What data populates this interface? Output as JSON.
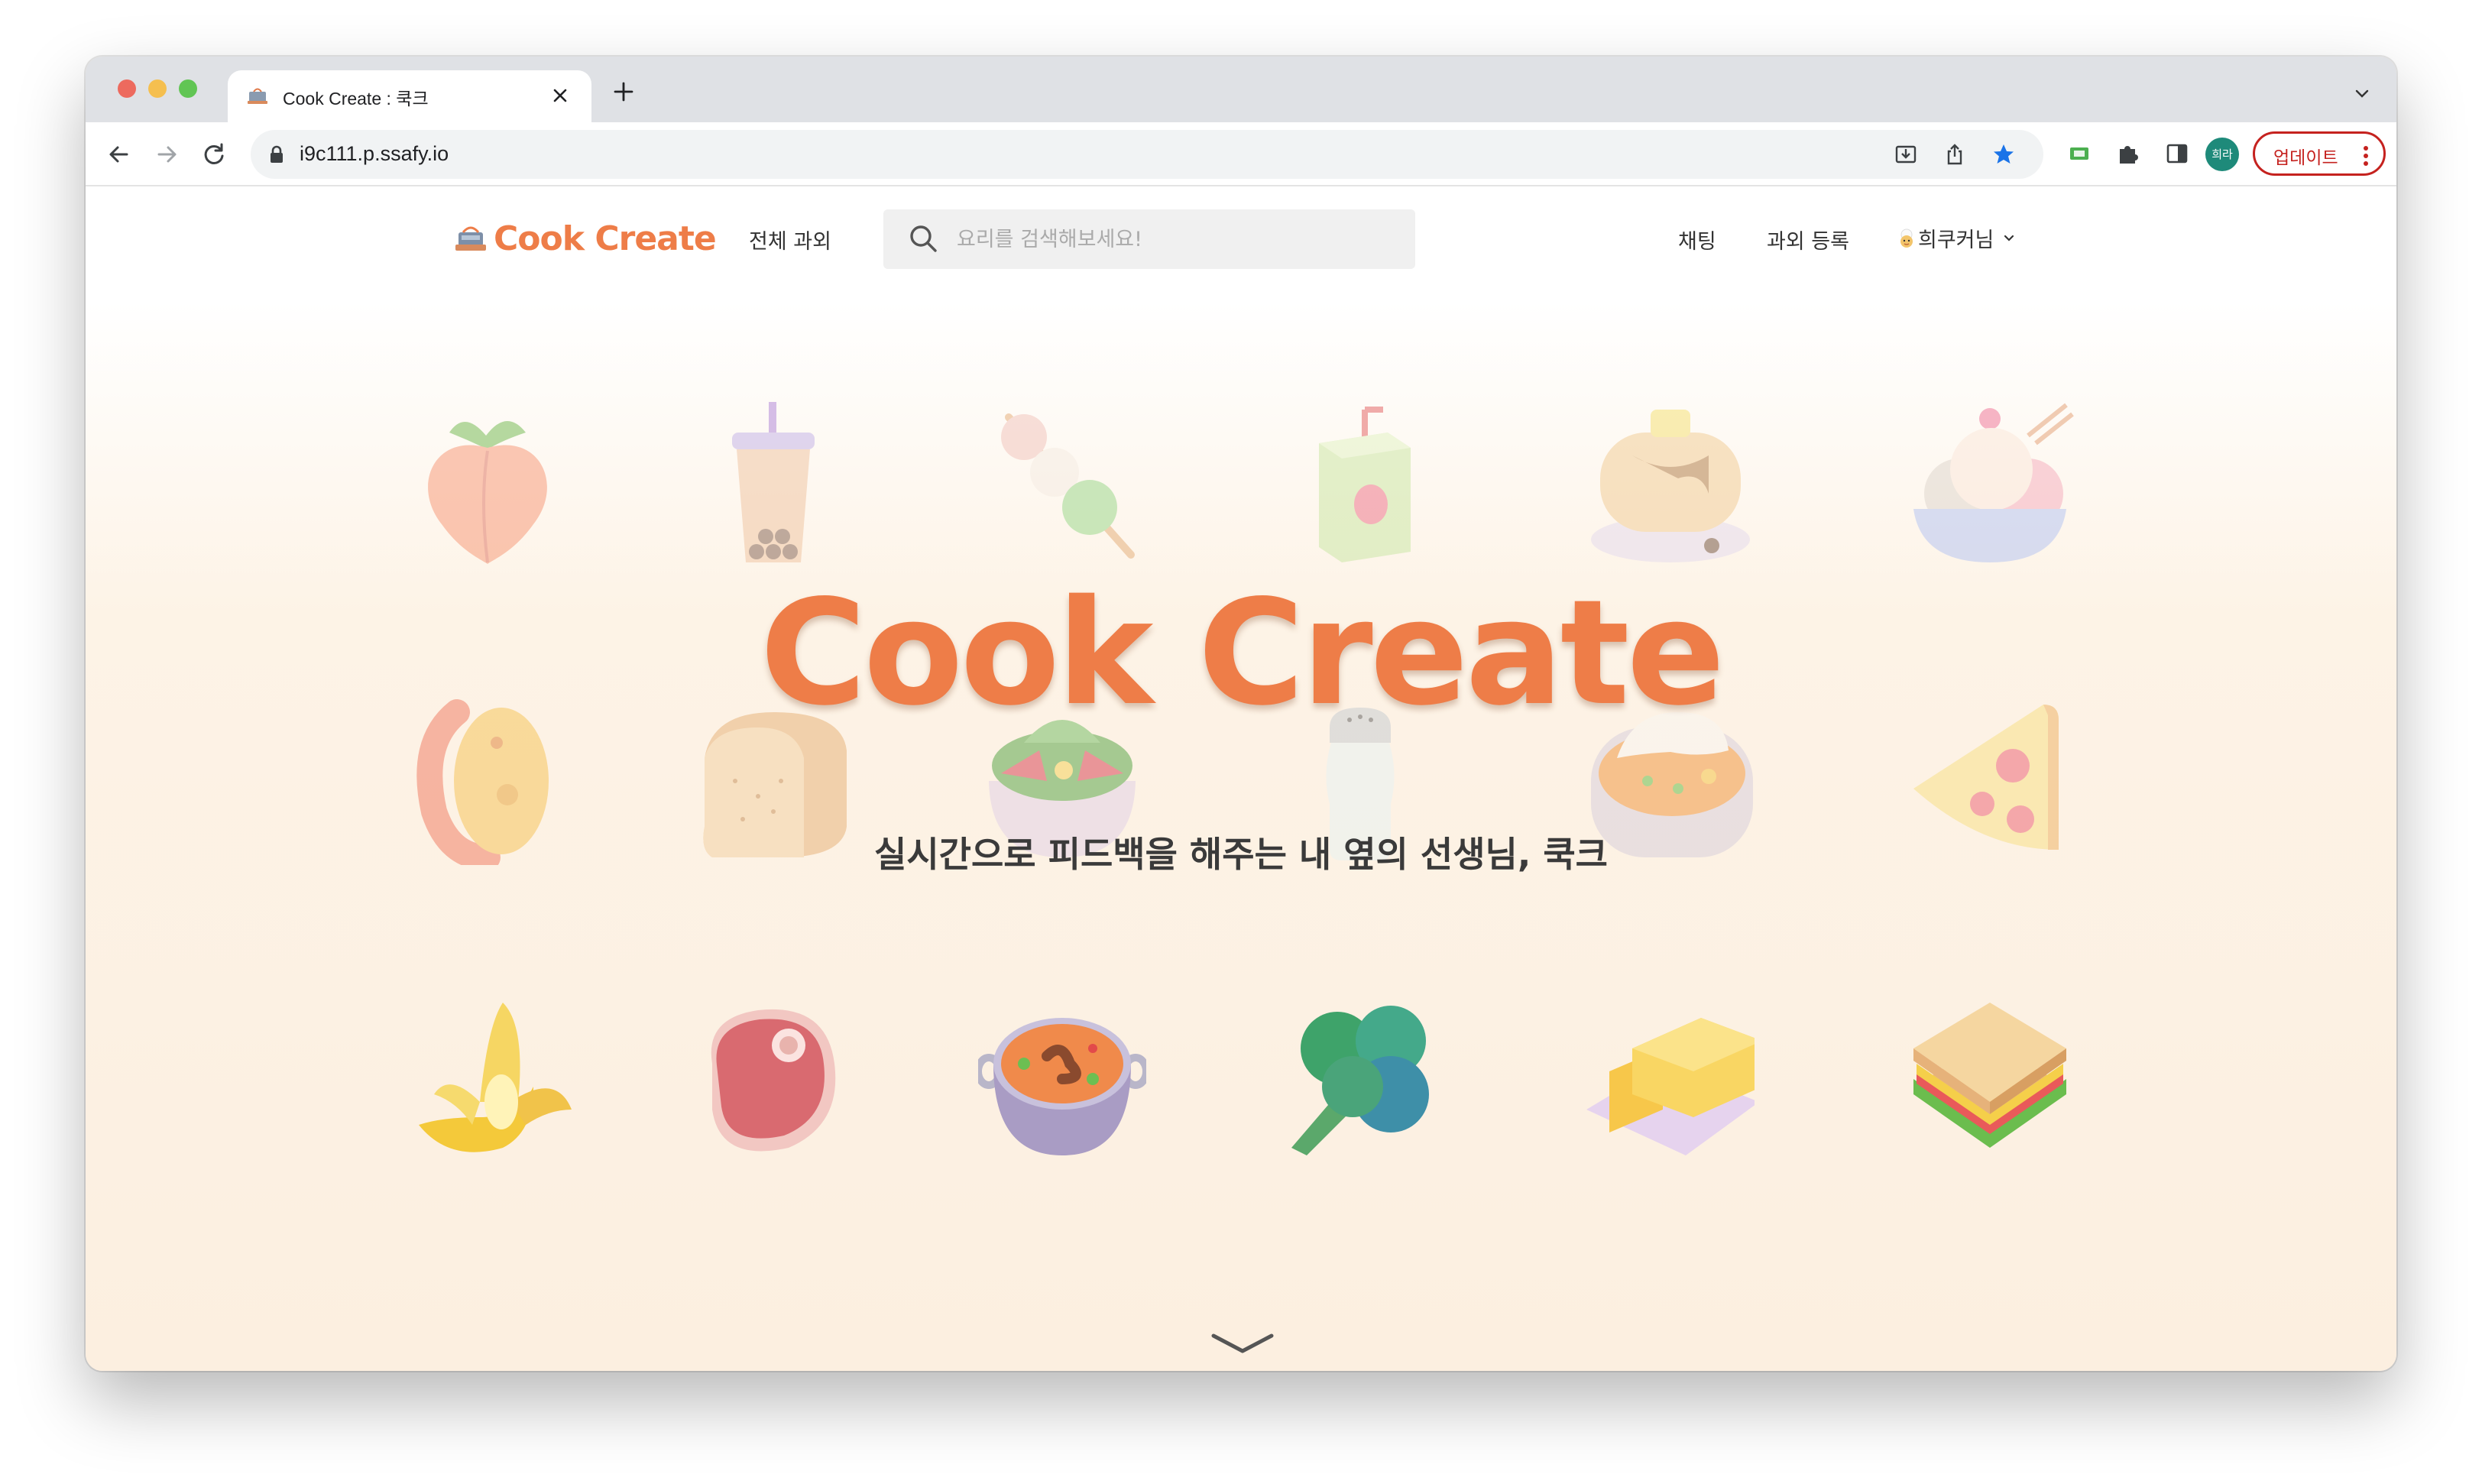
{
  "browser": {
    "tab_title": "Cook Create : 쿡크",
    "url": "i9c111.p.ssafy.io",
    "profile_initials": "희라",
    "update_label": "업데이트"
  },
  "site": {
    "logo_text": "Cook Create",
    "nav": {
      "all_lessons": "전체 과외",
      "chat": "채팅",
      "register_lesson": "과외 등록",
      "user_name": "희쿠커님"
    },
    "search_placeholder": "요리를 검색해보세요!"
  },
  "hero": {
    "title": "Cook Create",
    "subtitle": "실시간으로 피드백을 해주는 내 옆의 선생님, 쿡크"
  },
  "food_icons": [
    "peach-icon",
    "bubble-tea-icon",
    "dango-icon",
    "juice-box-icon",
    "pancakes-icon",
    "ice-cream-icon",
    "shrimp-icon",
    "bread-icon",
    "salad-icon",
    "salt-shaker-icon",
    "curry-rice-icon",
    "pizza-icon",
    "banana-icon",
    "meat-icon",
    "stew-pot-icon",
    "broccoli-icon",
    "butter-icon",
    "sandwich-icon"
  ],
  "colors": {
    "brand": "#ee7d48",
    "page_bg": "#fcefe0",
    "update_red": "#c5221f"
  }
}
